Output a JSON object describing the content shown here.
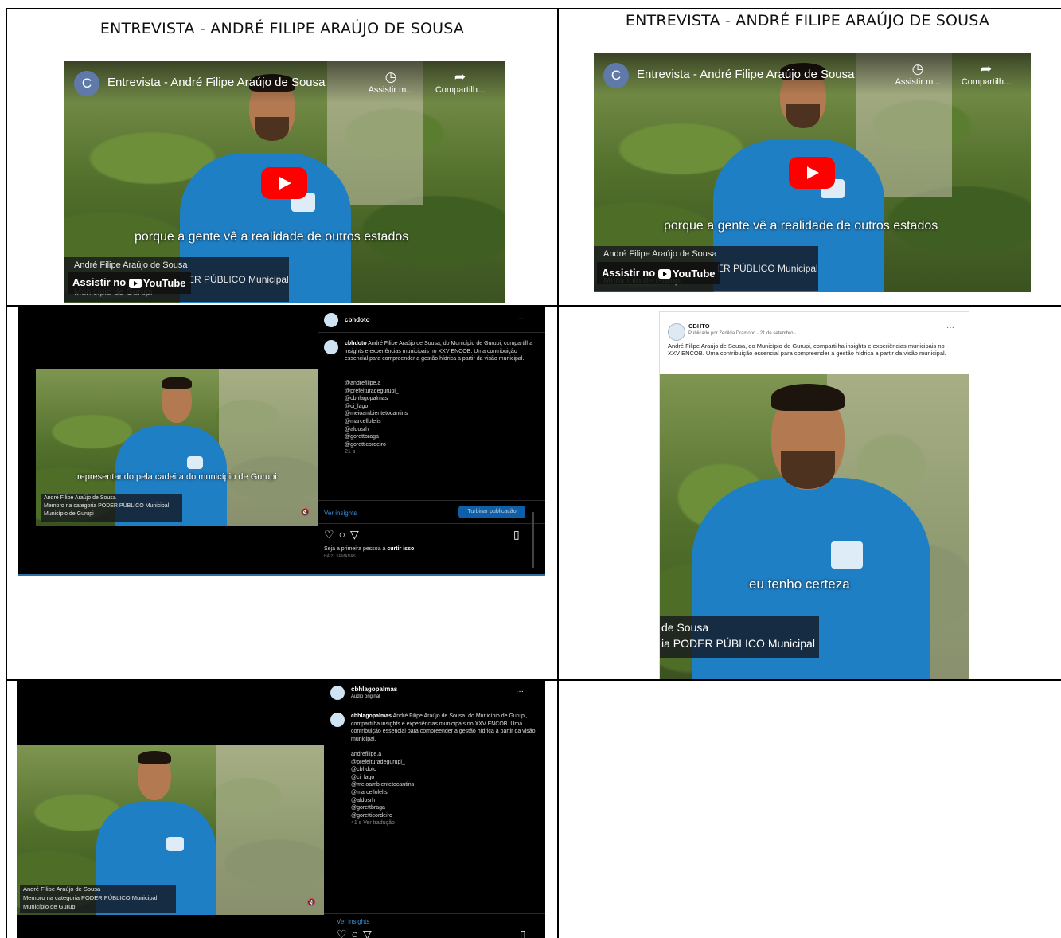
{
  "cell1": {
    "heading": "ENTREVISTA - ANDRÉ FILIPE ARAÚJO DE SOUSA",
    "channel_initial": "C",
    "video_title": "Entrevista - André Filipe Araújo de Sousa",
    "watch_later": "Assistir m...",
    "share": "Compartilh...",
    "caption": "porque a gente vê a realidade de outros estados",
    "lower_name": "André Filipe Araújo de Sousa",
    "lower_role": "ER PÚBLICO Municipal",
    "lower_city": "Município de Gurupi",
    "watch_on": "Assistir no",
    "youtube": "YouTube"
  },
  "cell2": {
    "heading": "ENTREVISTA - ANDRÉ FILIPE ARAÚJO DE SOUSA",
    "channel_initial": "C",
    "video_title": "Entrevista - André Filipe Araújo de Sousa",
    "watch_later": "Assistir m...",
    "share": "Compartilh...",
    "caption": "porque a gente vê a realidade de outros estados",
    "lower_name": "André Filipe Araújo de Sousa",
    "lower_role": "ER PÚBLICO Municipal",
    "lower_city": "Município de Gurupi",
    "watch_on": "Assistir no",
    "youtube": "YouTube"
  },
  "cell3": {
    "username": "cbhdoto",
    "caption_user": "cbhdoto",
    "caption": "André Filipe Araújo de Sousa, do Município de Gurupi, compartilha insights e experiências municipais no XXV ENCOB. Uma contribuição essencial para compreender a gestão hídrica a partir da visão municipal.",
    "tags": [
      "@andrefilipe.a",
      "@prefeituradegurupi_",
      "@cbhlagopalmas",
      "@ci_lago",
      "@meioambientetocantins",
      "@marcellolelis",
      "@aldosrh",
      "@gorettbraga",
      "@goretticordeiro"
    ],
    "time": "21 s",
    "video_caption": "representando pela cadeira do município de Gurupi",
    "lower_name": "André Filipe Araújo de Sousa",
    "lower_role": "Membro na categoria PODER PÚBLICO Municipal",
    "lower_city": "Município de Gurupi",
    "insights": "Ver insights",
    "boost": "Turbinar publicação",
    "first_like": "Seja a primeira pessoa a",
    "first_like_bold": "curtir isso",
    "date": "HÁ 21 SEMANAS"
  },
  "cell4": {
    "page_name": "CBHTO",
    "published_by": "Publicado por Zenilda Dramond · 21 de setembro ·",
    "post_text": "André Filipe Araújo de Sousa, do Município de Gurupi, compartilha insights e experiências municipais no XXV ENCOB. Uma contribuição essencial para compreender a gestão hídrica a partir da visão municipal.",
    "caption": "eu tenho certeza",
    "lower_name": "de Sousa",
    "lower_role": "ia PODER PÚBLICO Municipal"
  },
  "cell5": {
    "username": "cbhlagopalmas",
    "audio": "Áudio original",
    "caption_user": "cbhlagopalmas",
    "caption": "André Filipe Araújo de Sousa, do Município de Gurupi, compartilha insights e experiências municipais no XXV ENCOB. Uma contribuição essencial para compreender a gestão hídrica a partir da visão municipal.",
    "tags": [
      "andrefilipe.a",
      "@prefeituradegurupi_",
      "@cbhdoto",
      "@ci_lago",
      "@meioambientetocantins",
      "@marcellolelis",
      "@aldosrh",
      "@gorettbraga",
      "@goretticordeiro"
    ],
    "time": "41 s",
    "translation": "Ver tradução",
    "lower_name": "André Filipe Araújo de Sousa",
    "lower_role": "Membro na categoria PODER PÚBLICO Municipal",
    "lower_city": "Município de Gurupi",
    "insights": "Ver insights"
  },
  "colors": {
    "youtube_red": "#ff0000",
    "shirt_blue": "#1f7fc4",
    "ig_bg": "#000000",
    "link_blue": "#3b8fd8"
  }
}
